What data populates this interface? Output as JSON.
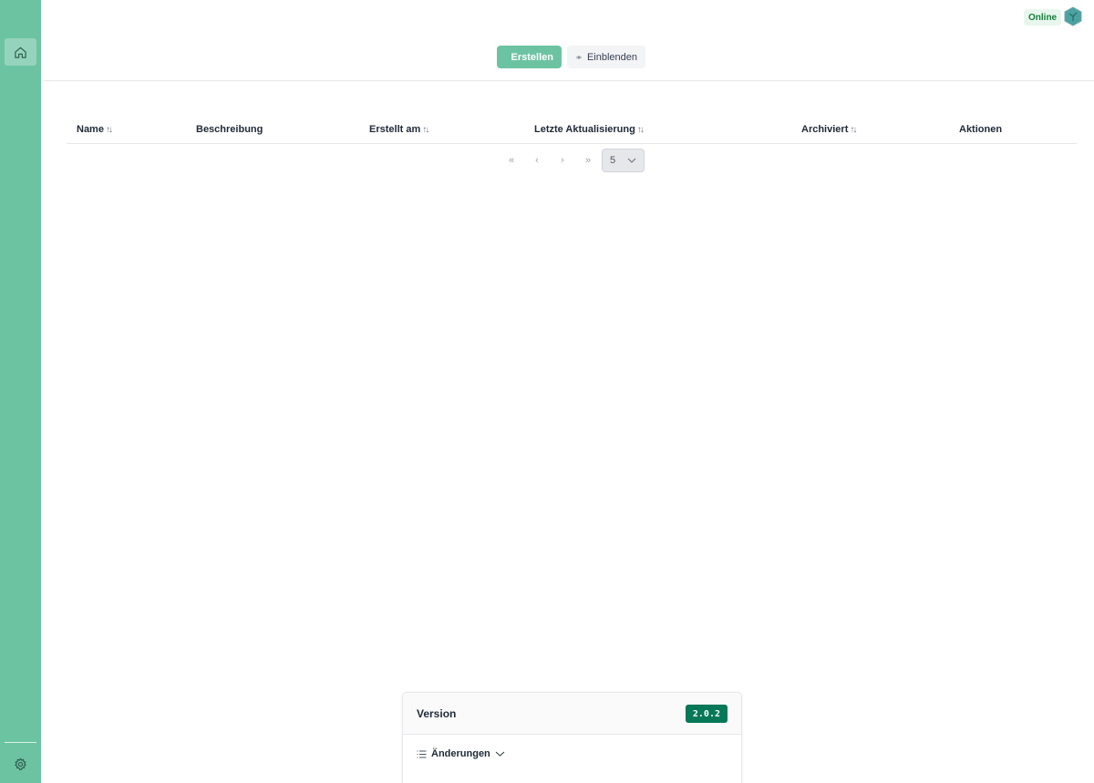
{
  "header": {
    "status": "Online"
  },
  "toolbar": {
    "create_label": "Erstellen",
    "show_label": "Einblenden"
  },
  "table": {
    "columns": [
      {
        "label": "Name",
        "sortable": true
      },
      {
        "label": "Beschreibung",
        "sortable": false
      },
      {
        "label": "Erstellt am",
        "sortable": true
      },
      {
        "label": "Letzte Aktualisierung",
        "sortable": true
      },
      {
        "label": "Archiviert",
        "sortable": true
      },
      {
        "label": "Aktionen",
        "sortable": false
      }
    ],
    "rows": []
  },
  "pagination": {
    "page_size": "5"
  },
  "version_card": {
    "title": "Version",
    "version": "2.0.2",
    "changes_label": "Änderungen"
  },
  "colors": {
    "sidebar": "#6cc3a2",
    "accent": "#6cc3a2",
    "version_badge": "#047857",
    "online": "#15803d"
  },
  "icons": {
    "sidebar_top": "home-icon",
    "sidebar_bottom": "gear-icon",
    "create": "plus-icon",
    "show": "eye-icon",
    "changes": "list-icon",
    "expand": "chevron-down-icon"
  }
}
